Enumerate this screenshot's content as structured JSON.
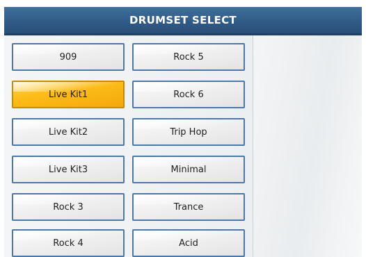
{
  "header": {
    "title": "DRUMSET SELECT"
  },
  "drumsets": {
    "left": [
      "909",
      "Live Kit1",
      "Live Kit2",
      "Live Kit3",
      "Rock 3",
      "Rock 4"
    ],
    "right": [
      "Rock 5",
      "Rock 6",
      "Trip Hop",
      "Minimal",
      "Trance",
      "Acid"
    ],
    "selected": "Live Kit1"
  },
  "colors": {
    "header": "#2f5a86",
    "button_border": "#4b78a6",
    "selected": "#fcbc19"
  }
}
